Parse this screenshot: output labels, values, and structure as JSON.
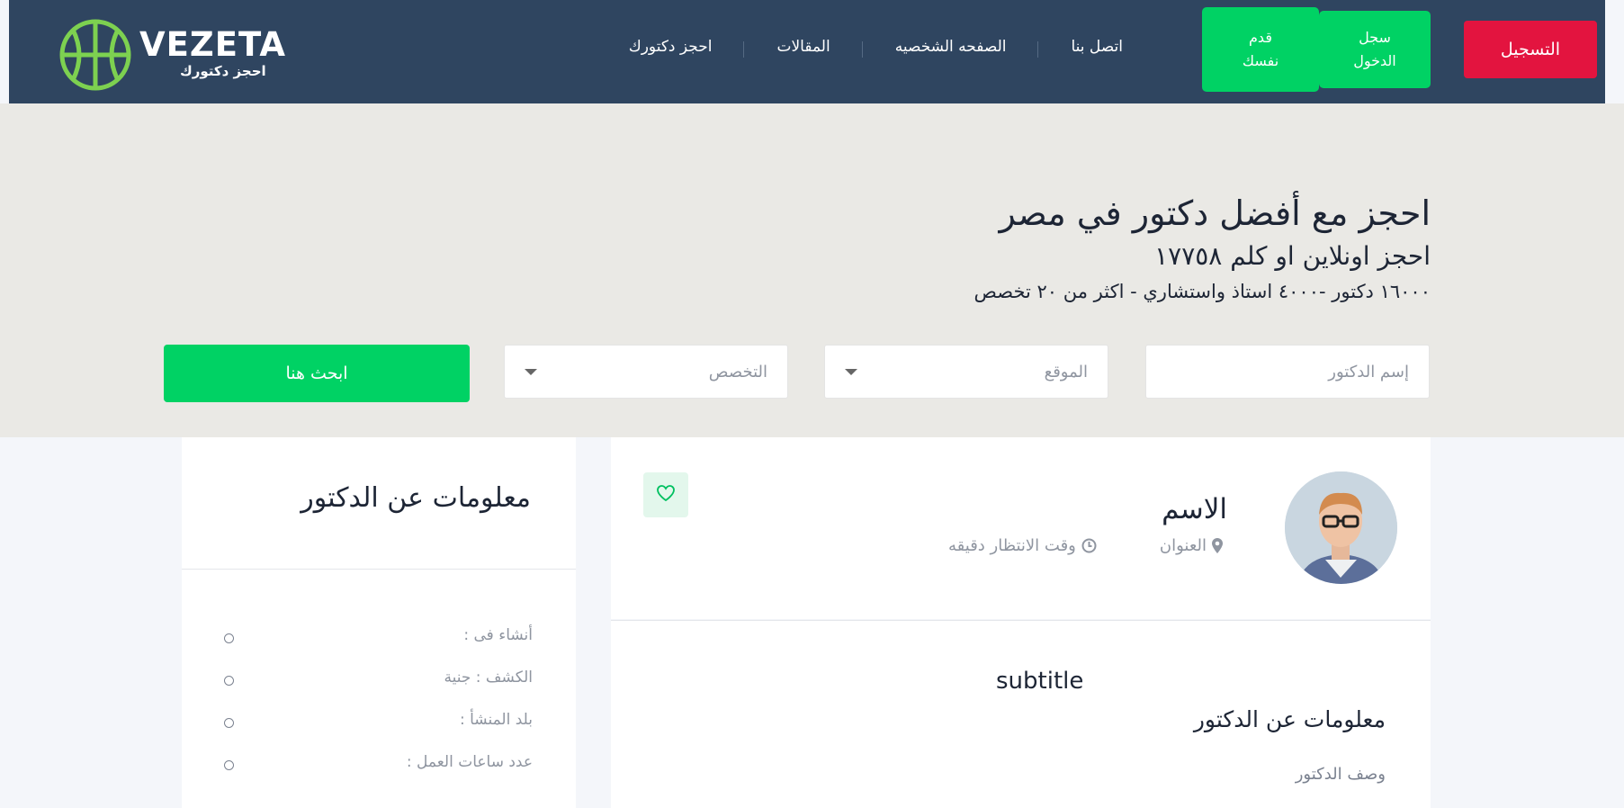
{
  "brand": {
    "name": "VEZETA",
    "tagline": "احجز دكتورك",
    "logo_color": "#7dd150"
  },
  "nav": {
    "links": [
      "احجز دكتورك",
      "المقالات",
      "الصفحه الشخصيه",
      "اتصل بنا"
    ],
    "login_label": "سجل الدخول",
    "join_label": "قدم نفسك",
    "register_label": "التسجيل"
  },
  "hero": {
    "title": "احجز مع أفضل دكتور في مصر",
    "subtitle": "احجز اونلاين او كلم ١٧٧٥٨",
    "stats": "١٦٠٠٠ دكتور -٤٠٠٠ استاذ واستشاري - اكثر من ٢٠ تخصص"
  },
  "search": {
    "doctor_placeholder": "إسم الدكتور",
    "location_placeholder": "الموقع",
    "specialty_placeholder": "التخصص",
    "button_label": "ابحث هنا"
  },
  "info_card": {
    "title": "معلومات عن الدكتور",
    "rows": [
      "أنشاء فى :",
      "الكشف : جنية",
      "بلد المنشأ :",
      "عدد ساعات العمل :"
    ]
  },
  "doctor": {
    "name": "الاسم",
    "address": "العنوان",
    "wait_time": "وقت الانتظار دقيقه",
    "icons": [
      "map-pin-icon",
      "clock-icon",
      "heart-icon"
    ]
  },
  "description": {
    "subtitle": "subtitle",
    "title": "معلومات عن الدكتور",
    "text": "وصف الدكتور"
  },
  "colors": {
    "navbar": "#2f4560",
    "accent_green": "#00d264",
    "register_red": "#e3143f",
    "hero_bg": "#eae9e5"
  }
}
